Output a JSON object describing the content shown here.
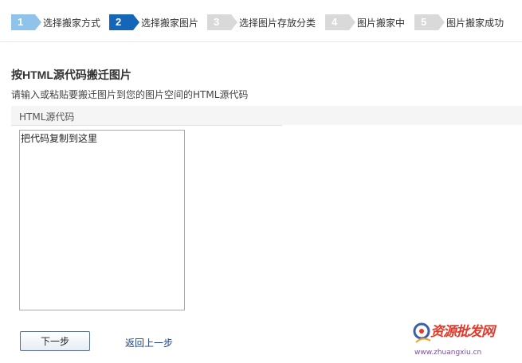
{
  "steps": [
    {
      "num": "1",
      "label": "选择搬家方式",
      "state": "done"
    },
    {
      "num": "2",
      "label": "选择搬家图片",
      "state": "active"
    },
    {
      "num": "3",
      "label": "选择图片存放分类",
      "state": "pending"
    },
    {
      "num": "4",
      "label": "图片搬家中",
      "state": "pending"
    },
    {
      "num": "5",
      "label": "图片搬家成功",
      "state": "pending"
    }
  ],
  "section": {
    "title": "按HTML源代码搬迁图片",
    "hint": "请输入或粘贴要搬迁图片到您的图片空间的HTML源代码"
  },
  "field": {
    "label": "HTML源代码",
    "value": "把代码复制到这里"
  },
  "actions": {
    "next_label": "下一步",
    "back_label": "返回上一步"
  },
  "watermark": {
    "text": "资源批发网",
    "url": "www.zhuangxiu.cn"
  },
  "colors": {
    "step_done": "#8fc3ea",
    "step_active": "#1566b8",
    "step_pending": "#d9d9d9",
    "link": "#1a3e86"
  }
}
